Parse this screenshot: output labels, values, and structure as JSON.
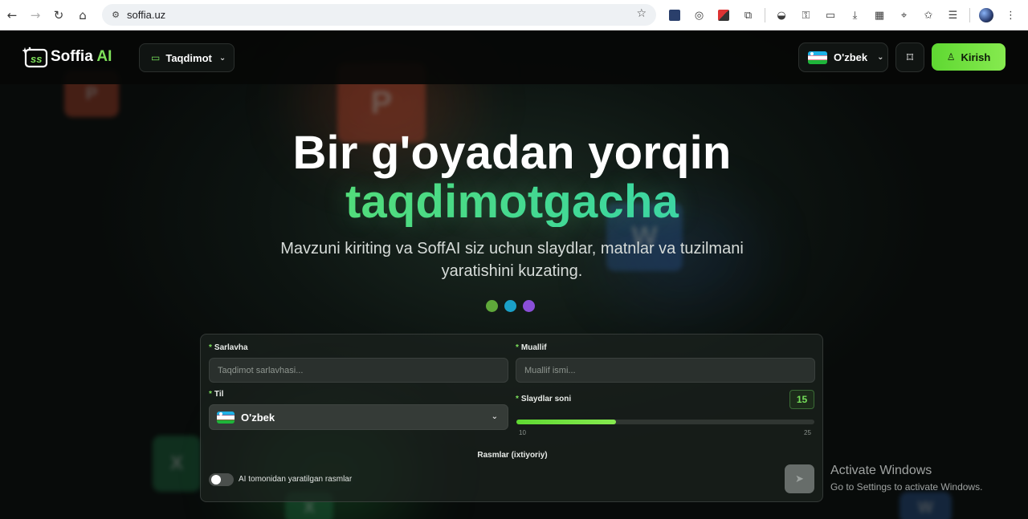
{
  "browser": {
    "url": "soffia.uz"
  },
  "nav": {
    "logo_text": "Soffia",
    "logo_accent": "AI",
    "presentation_label": "Taqdimot",
    "language_label": "O'zbek",
    "login_label": "Kirish"
  },
  "hero": {
    "title_line1": "Bir g'oyadan yorqin",
    "title_line2": "taqdimotgacha",
    "subtitle": "Mavzuni kiriting va SoffAI siz uchun slaydlar, matnlar va tuzilmani yaratishini kuzating."
  },
  "form": {
    "title_label": "Sarlavha",
    "title_placeholder": "Taqdimot sarlavhasi...",
    "author_label": "Muallif",
    "author_placeholder": "Muallif ismi...",
    "language_label": "Til",
    "language_value": "O'zbek",
    "slides_label": "Slaydlar soni",
    "slides_value": "15",
    "slides_min": "10",
    "slides_max": "25",
    "images_label": "Rasmlar (ixtiyoriy)",
    "ai_images_label": "AI tomonidan yaratilgan rasmlar",
    "ai_images_enabled": false
  },
  "watermark": {
    "line1": "Activate Windows",
    "line2": "Go to Settings to activate Windows."
  },
  "colors": {
    "accent_green": "#6ee34e",
    "dot1": "#5fa83a",
    "dot2": "#1aa0c8",
    "dot3": "#8a4fd8"
  }
}
